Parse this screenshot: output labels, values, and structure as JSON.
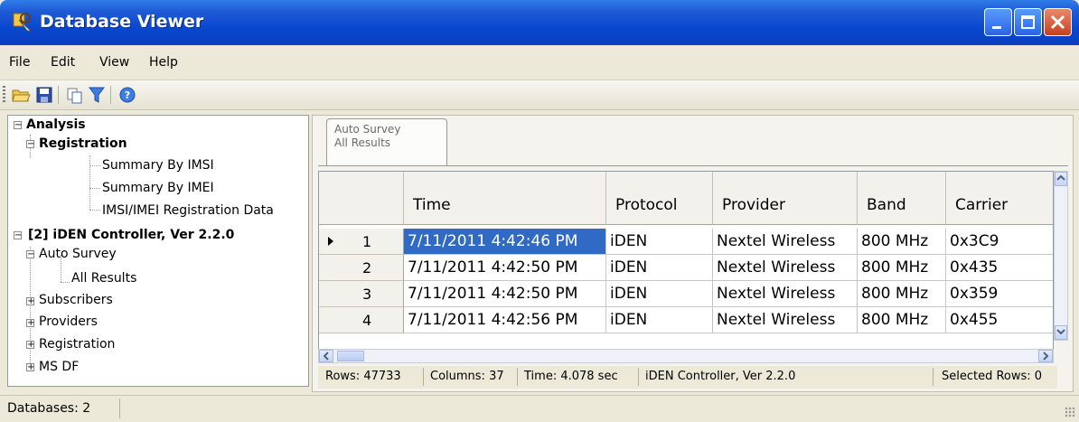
{
  "window": {
    "title": "Database Viewer"
  },
  "menu": {
    "items": [
      "File",
      "Edit",
      "View",
      "Help"
    ]
  },
  "toolbar": {
    "icons": [
      "open-folder-icon",
      "save-icon",
      "copy-icon",
      "filter-icon",
      "help-icon"
    ]
  },
  "tree": {
    "analysis": "Analysis",
    "registration": "Registration",
    "summary_imsi": "Summary By IMSI",
    "summary_imei": "Summary By IMEI",
    "imsi_imei_reg": "IMSI/IMEI Registration Data",
    "controller": "[2]  iDEN Controller, Ver 2.2.0",
    "auto_survey": "Auto Survey",
    "all_results": "All Results",
    "subscribers": "Subscribers",
    "providers": "Providers",
    "registration2": "Registration",
    "ms_df": "MS DF"
  },
  "tab": {
    "line1": "Auto Survey",
    "line2": "All Results"
  },
  "grid": {
    "columns": [
      "Time",
      "Protocol",
      "Provider",
      "Band",
      "Carrier"
    ],
    "rows": [
      {
        "num": "1",
        "time": "7/11/2011 4:42:46 PM",
        "protocol": "iDEN",
        "provider": "Nextel Wireless",
        "band": "800 MHz",
        "carrier": "0x3C9"
      },
      {
        "num": "2",
        "time": "7/11/2011 4:42:50 PM",
        "protocol": "iDEN",
        "provider": "Nextel Wireless",
        "band": "800 MHz",
        "carrier": "0x435"
      },
      {
        "num": "3",
        "time": "7/11/2011 4:42:50 PM",
        "protocol": "iDEN",
        "provider": "Nextel Wireless",
        "band": "800 MHz",
        "carrier": "0x359"
      },
      {
        "num": "4",
        "time": "7/11/2011 4:42:56 PM",
        "protocol": "iDEN",
        "provider": "Nextel Wireless",
        "band": "800 MHz",
        "carrier": "0x455"
      }
    ]
  },
  "grid_status": {
    "rows": "Rows: 47733",
    "columns": "Columns: 37",
    "time": "Time: 4.078 sec",
    "source": "iDEN Controller, Ver 2.2.0",
    "selected": "Selected Rows: 0"
  },
  "status": {
    "databases": "Databases: 2"
  },
  "colors": {
    "selection": "#316ac5",
    "titlebar": "#0a48d0"
  }
}
